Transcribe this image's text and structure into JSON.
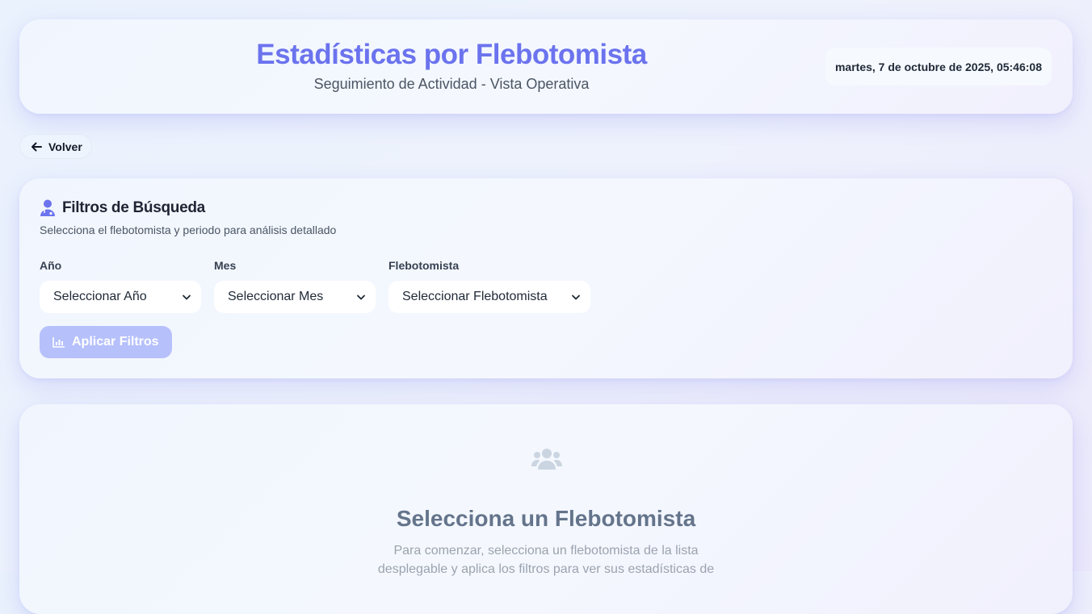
{
  "header": {
    "title": "Estadísticas por Flebotomista",
    "subtitle": "Seguimiento de Actividad - Vista Operativa",
    "datetime": "martes, 7 de octubre de 2025, 05:46:08"
  },
  "back_button": {
    "label": "Volver",
    "icon": "arrow-left-icon"
  },
  "filters": {
    "title": "Filtros de Búsqueda",
    "title_icon": "user-doctor-icon",
    "description": "Selecciona el flebotomista y periodo para análisis detallado",
    "year": {
      "label": "Año",
      "value": "Seleccionar Año"
    },
    "month": {
      "label": "Mes",
      "value": "Seleccionar Mes"
    },
    "phlebotomist": {
      "label": "Flebotomista",
      "value": "Seleccionar Flebotomista"
    },
    "apply_button": {
      "label": "Aplicar Filtros",
      "icon": "chart-bar-icon"
    }
  },
  "empty_state": {
    "icon": "users-icon",
    "title": "Selecciona un Flebotomista",
    "text": "Para comenzar, selecciona un flebotomista de la lista desplegable y aplica los filtros para ver sus estadísticas de"
  },
  "colors": {
    "accent": "#6b73ee",
    "apply_disabled": "#b6c0fb",
    "empty_icon": "#cbd5e1"
  }
}
